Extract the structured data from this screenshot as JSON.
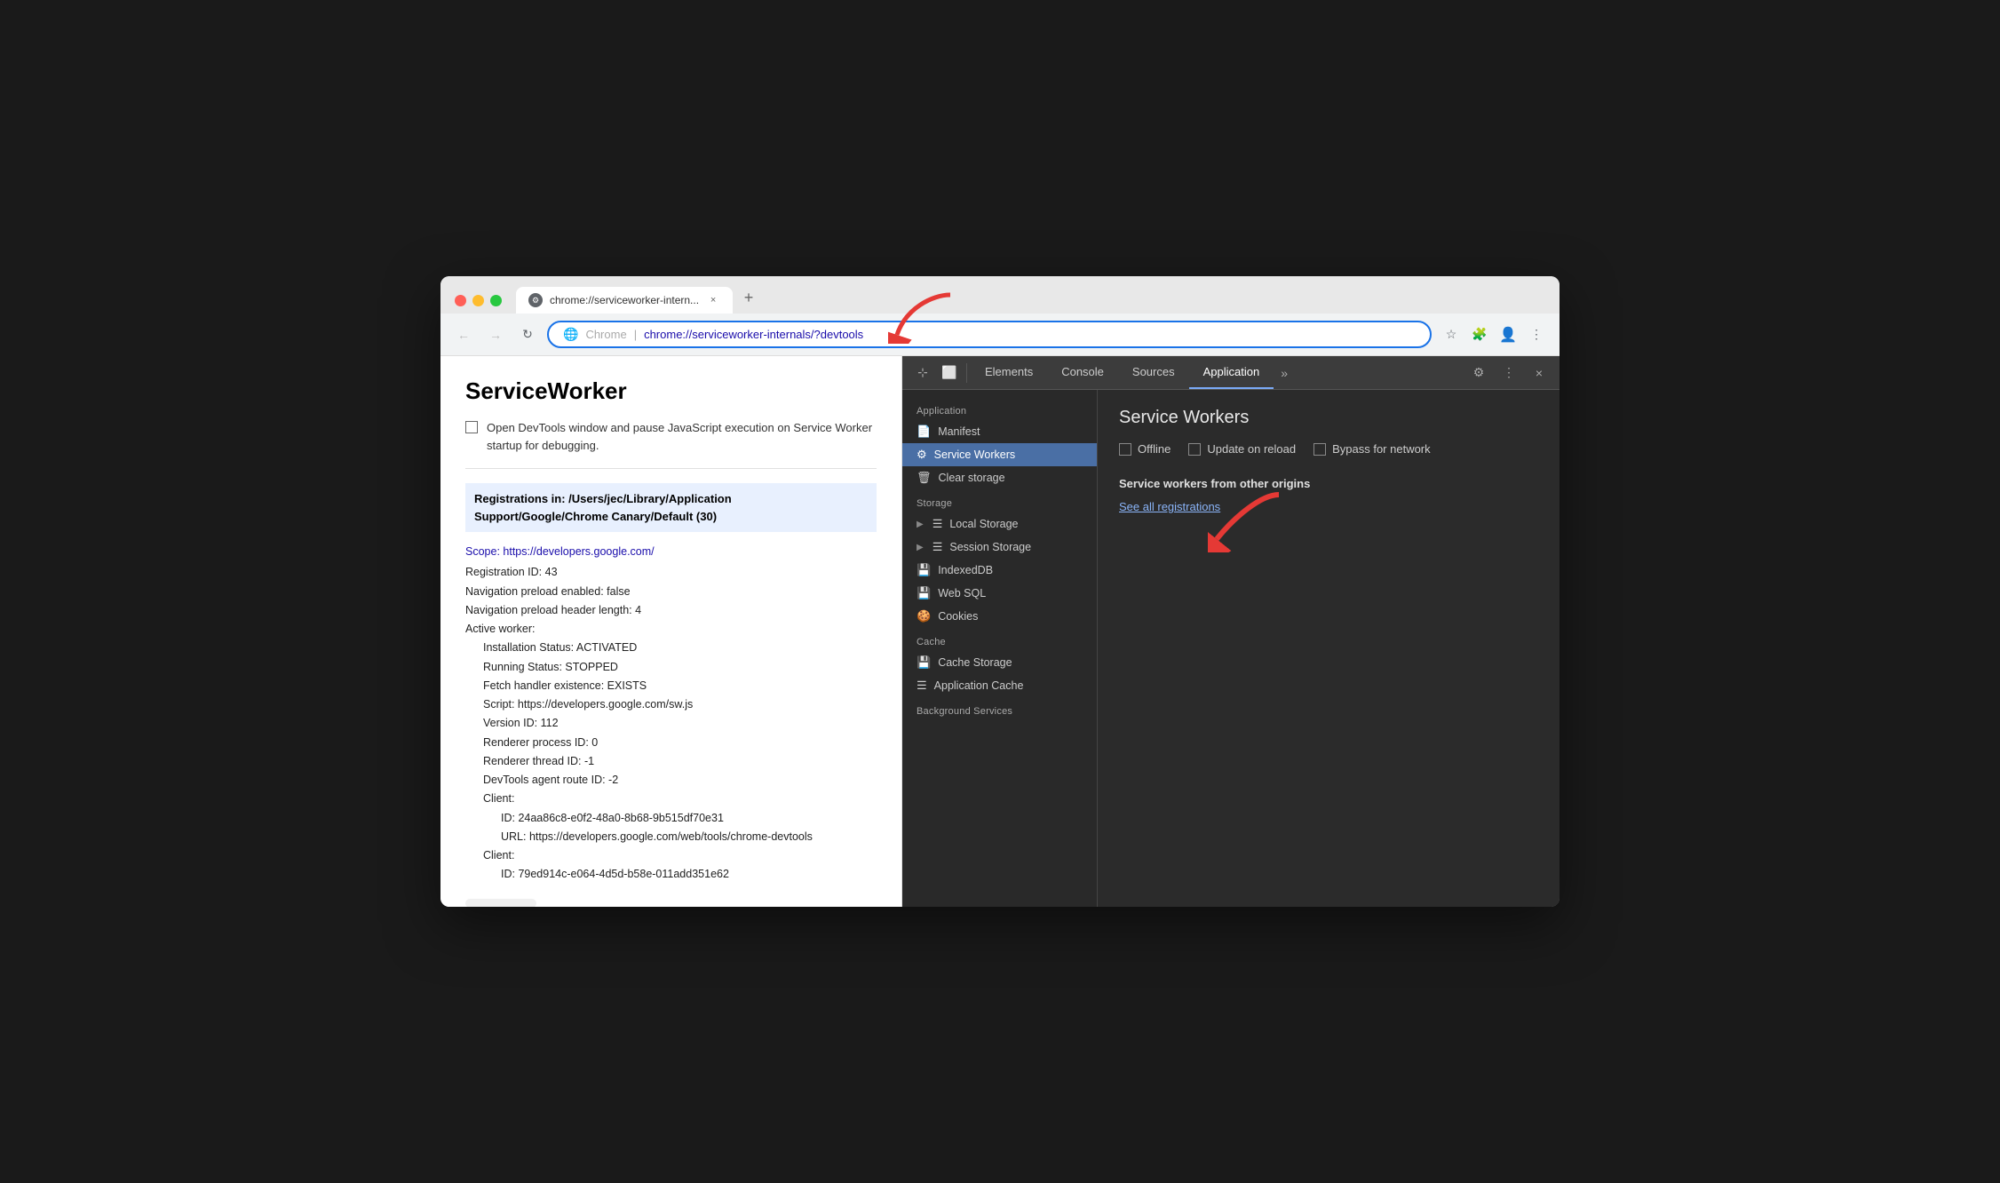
{
  "browser": {
    "tab_title": "chrome://serviceworker-intern...",
    "tab_close": "×",
    "new_tab": "+",
    "url_domain": "Chrome",
    "url_separator": "|",
    "url_full": "chrome://serviceworker-internals/?devtools",
    "back_btn": "‹",
    "forward_btn": "›",
    "refresh_btn": "↻",
    "bookmark_icon": "☆",
    "extension_icon": "⚙",
    "menu_icon": "⋮"
  },
  "page": {
    "title": "ServiceWorker",
    "checkbox_label": "Open DevTools window and pause JavaScript execution on Service Worker startup for debugging.",
    "registrations_header": "Registrations in: /Users/jec/Library/Application Support/Google/Chrome Canary/Default (30)",
    "scope_label": "Scope: https://developers.google.com/",
    "details": [
      "Registration ID: 43",
      "Navigation preload enabled: false",
      "Navigation preload header length: 4",
      "Active worker:",
      "Installation Status: ACTIVATED",
      "Running Status: STOPPED",
      "Fetch handler existence: EXISTS",
      "Script: https://developers.google.com/sw.js",
      "Version ID: 112",
      "Renderer process ID: 0",
      "Renderer thread ID: -1",
      "DevTools agent route ID: -2",
      "Client:",
      "ID: 24aa86c8-e0f2-48a0-8b68-9b515df70e31",
      "URL: https://developers.google.com/web/tools/chrome-devtools",
      "Client:",
      "ID: 79ed914c-e064-4d5d-b58e-011add351e62"
    ]
  },
  "devtools": {
    "tabs": [
      {
        "label": "Elements",
        "active": false
      },
      {
        "label": "Console",
        "active": false
      },
      {
        "label": "Sources",
        "active": false
      },
      {
        "label": "Application",
        "active": true
      }
    ],
    "more_tabs": "»",
    "settings_icon": "⚙",
    "more_icon": "⋮",
    "close_icon": "×",
    "cursor_icon": "⊹",
    "device_icon": "⬜",
    "sidebar": {
      "application_header": "Application",
      "application_items": [
        {
          "label": "Manifest",
          "icon": "📄"
        },
        {
          "label": "Service Workers",
          "icon": "⚙",
          "active": true
        },
        {
          "label": "Clear storage",
          "icon": "🗑"
        }
      ],
      "storage_header": "Storage",
      "storage_items": [
        {
          "label": "Local Storage",
          "icon": "☰",
          "expandable": true
        },
        {
          "label": "Session Storage",
          "icon": "☰",
          "expandable": true
        },
        {
          "label": "IndexedDB",
          "icon": "💾"
        },
        {
          "label": "Web SQL",
          "icon": "💾"
        },
        {
          "label": "Cookies",
          "icon": "🍪"
        }
      ],
      "cache_header": "Cache",
      "cache_items": [
        {
          "label": "Cache Storage",
          "icon": "💾"
        },
        {
          "label": "Application Cache",
          "icon": "☰"
        }
      ],
      "bg_header": "Background Services"
    },
    "main": {
      "title": "Service Workers",
      "options": [
        {
          "label": "Offline"
        },
        {
          "label": "Update on reload"
        },
        {
          "label": "Bypass for network"
        }
      ],
      "other_origins_title": "Service workers from other origins",
      "see_all_link": "See all registrations"
    }
  }
}
